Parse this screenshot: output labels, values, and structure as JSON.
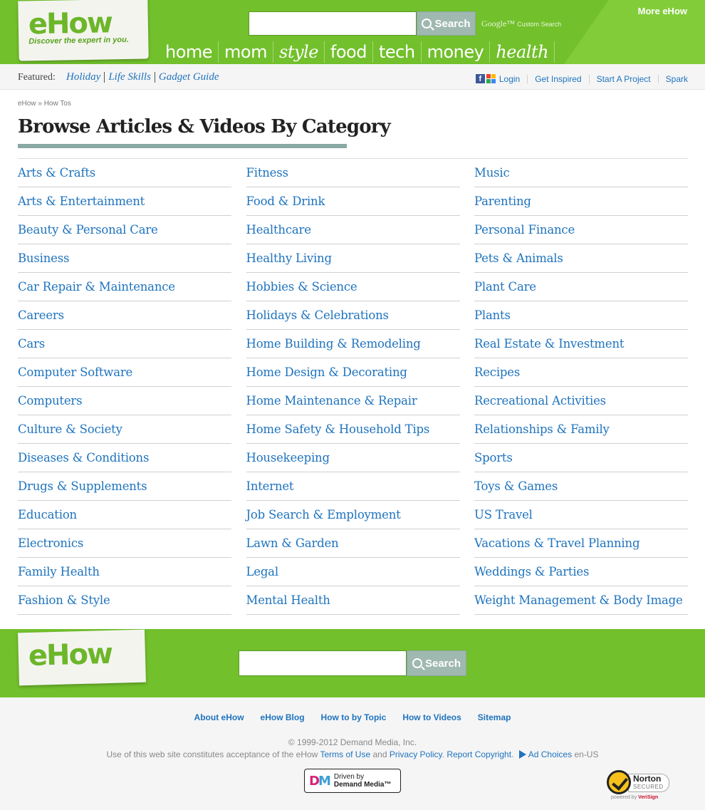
{
  "header": {
    "logo": "eHow",
    "tagline": "Discover the expert in you.",
    "search_button": "Search",
    "search_placeholder": "",
    "google_brand": "Google™",
    "custom_search": "Custom Search",
    "more_link": "More eHow",
    "nav": [
      "home",
      "mom",
      "style",
      "food",
      "tech",
      "money",
      "health"
    ]
  },
  "featured": {
    "label": "Featured:",
    "links": [
      "Holiday",
      "Life Skills",
      "Gadget Guide"
    ]
  },
  "user_links": [
    "Login",
    "Get Inspired",
    "Start A Project",
    "Spark"
  ],
  "breadcrumb": {
    "home": "eHow",
    "sep": "»",
    "current": "How Tos"
  },
  "page_title": "Browse Articles & Videos By Category",
  "categories": {
    "col1": [
      "Arts & Crafts",
      "Arts & Entertainment",
      "Beauty & Personal Care",
      "Business",
      "Car Repair & Maintenance",
      "Careers",
      "Cars",
      "Computer Software",
      "Computers",
      "Culture & Society",
      "Diseases & Conditions",
      "Drugs & Supplements",
      "Education",
      "Electronics",
      "Family Health",
      "Fashion & Style"
    ],
    "col2": [
      "Fitness",
      "Food & Drink",
      "Healthcare",
      "Healthy Living",
      "Hobbies & Science",
      "Holidays & Celebrations",
      "Home Building & Remodeling",
      "Home Design & Decorating",
      "Home Maintenance & Repair",
      "Home Safety & Household Tips",
      "Housekeeping",
      "Internet",
      "Job Search & Employment",
      "Lawn & Garden",
      "Legal",
      "Mental Health"
    ],
    "col3": [
      "Music",
      "Parenting",
      "Personal Finance",
      "Pets & Animals",
      "Plant Care",
      "Plants",
      "Real Estate & Investment",
      "Recipes",
      "Recreational Activities",
      "Relationships & Family",
      "Sports",
      "Toys & Games",
      "US Travel",
      "Vacations & Travel Planning",
      "Weddings & Parties",
      "Weight Management & Body Image"
    ]
  },
  "footer": {
    "logo": "eHow",
    "search_button": "Search",
    "nav": [
      "About eHow",
      "eHow Blog",
      "How to by Topic",
      "How to Videos",
      "Sitemap"
    ],
    "copyright": "© 1999-2012 Demand Media, Inc.",
    "legal_prefix": "Use of this web site constitutes acceptance of the eHow",
    "terms": "Terms of Use",
    "and": "and",
    "privacy": "Privacy Policy",
    "report": "Report Copyright",
    "ad_choices": "Ad Choices",
    "locale": "en-US",
    "dm_line1": "Driven by",
    "dm_line2": "Demand Media™",
    "norton_name": "Norton",
    "norton_secured": "SECURED",
    "norton_powered": "powered by",
    "norton_verisign": "VeriSign"
  },
  "colors": {
    "brand_green": "#72c02c",
    "link_blue": "#1e73be",
    "title_underline": "#8aa8a4"
  }
}
